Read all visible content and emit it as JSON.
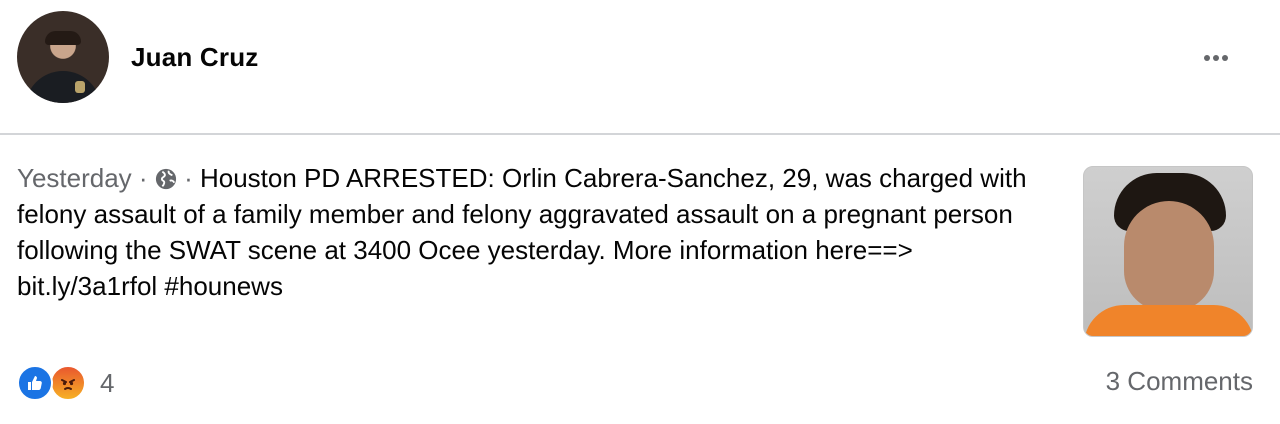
{
  "post": {
    "author": "Juan Cruz",
    "timestamp": "Yesterday",
    "separator": "·",
    "audience_icon": "globe-icon",
    "text_main": "Houston PD ARRESTED: Orlin Cabrera-Sanchez, 29, was charged with felony assault of a family member and felony aggravated assault on a pregnant person following the SWAT scene at 3400 Ocee yesterday. More information here==> ",
    "link": "bit.ly/3a1rfol",
    "hashtag": "#hounews"
  },
  "header": {
    "more_icon": "more-dots-icon"
  },
  "footer": {
    "reaction_icons": [
      "like-icon",
      "angry-icon"
    ],
    "reaction_count": "4",
    "comments_label": "3 Comments"
  },
  "colors": {
    "like": "#1b74e4",
    "angry": "#e9572e",
    "secondary_text": "#65676b",
    "divider": "#d3d5d8"
  }
}
